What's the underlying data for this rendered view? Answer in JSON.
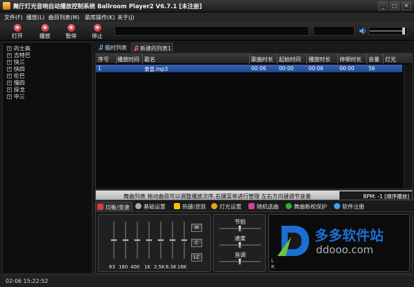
{
  "titlebar": {
    "title": "舞厅灯光音响自动播放控制系统 Ballroom Player2 V6.7.1 [未注册]"
  },
  "menu": [
    "文件(F)",
    "播放(L)",
    "曲目列表(M)",
    "歌库操作(K)",
    "关于(J)"
  ],
  "toolbar": [
    {
      "label": "打开",
      "icon": "open-icon"
    },
    {
      "label": "播放",
      "icon": "play-icon"
    },
    {
      "label": "暂停",
      "icon": "pause-icon"
    },
    {
      "label": "停止",
      "icon": "stop-icon"
    }
  ],
  "volume": {
    "level": 0.9
  },
  "tree": [
    "的士高",
    "吉特巴",
    "快三",
    "快四",
    "伦巴",
    "慢四",
    "探戈",
    "中三"
  ],
  "playlist_tabs": [
    "临时列表",
    "新建的列表1"
  ],
  "table": {
    "headers": [
      "序号",
      "播放时间",
      "歌名",
      "歌曲时长",
      "起始时间",
      "播放时长",
      "停顿时长",
      "音量",
      "灯光"
    ],
    "rows": [
      {
        "no": "1",
        "play_time": "",
        "name": "录音.mp3",
        "duration": "00:06",
        "start": "00:00",
        "play_len": "00:06",
        "pause": "00:00",
        "volume": "56",
        "light": ""
      }
    ]
  },
  "status": {
    "text": "舞曲列表 拖动曲目可以调整播放次序,右键菜单进行管理 左右方向键调节音量",
    "bpm": "BPM: -1",
    "mode": "[顺序播放]"
  },
  "panel_tabs": [
    "均衡/变速",
    "基础设置",
    "热键/皮肤",
    "灯光设置",
    "随机选曲",
    "舞曲断权保护",
    "软件注册"
  ],
  "eq": {
    "bands": [
      "63",
      "160",
      "400",
      "1K",
      "2.5K",
      "6.3K",
      "16K"
    ],
    "levels": [
      0.5,
      0.5,
      0.5,
      0.5,
      0.5,
      0.5,
      0.5
    ],
    "buttons": [
      "M",
      "C",
      "LC"
    ]
  },
  "controls": [
    {
      "label": "节拍",
      "value": 0.5
    },
    {
      "label": "速度",
      "value": 0.5
    },
    {
      "label": "音调",
      "value": 0.5
    }
  ],
  "vu": {
    "left": "L",
    "right": "R"
  },
  "watermark": {
    "brand": "多多软件站",
    "url": "ddooo.com"
  },
  "statusbar": {
    "time": "02-06 15:22:52"
  }
}
